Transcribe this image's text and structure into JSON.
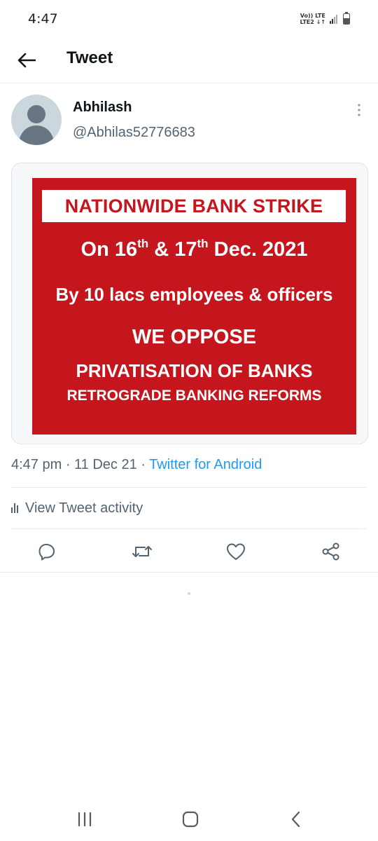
{
  "status_bar": {
    "time": "4:47",
    "network_line1": "Vo)) LTE",
    "network_line2": "LTE2 ↓↑",
    "battery_level": 0.6
  },
  "header": {
    "title": "Tweet",
    "back_icon": "arrow-left-icon"
  },
  "tweet": {
    "author_name": "Abhilash",
    "author_handle": "@Abhilas52776683",
    "more_icon": "vertical-dots-icon",
    "image": {
      "headline": "NATIONWIDE BANK STRIKE",
      "date_on": "On 16",
      "date_th1": "th",
      "date_mid": " & 17",
      "date_th2": "th",
      "date_end": " Dec. 2021",
      "by_line": "By 10 lacs employees & officers",
      "oppose": "WE OPPOSE",
      "privatisation": "PRIVATISATION OF BANKS",
      "retrograde": "RETROGRADE BANKING REFORMS",
      "bg_color": "#c4161c"
    },
    "meta": {
      "time": "4:47 pm",
      "separator": " · ",
      "date": "11 Dec 21",
      "source": "Twitter for Android"
    },
    "activity_label": "View Tweet activity",
    "activity_icon": "bar-chart-icon"
  },
  "actions": [
    {
      "name": "reply",
      "icon": "reply-icon"
    },
    {
      "name": "retweet",
      "icon": "retweet-icon"
    },
    {
      "name": "like",
      "icon": "heart-icon"
    },
    {
      "name": "share",
      "icon": "share-icon"
    }
  ],
  "colors": {
    "accent": "#1d9bf0",
    "secondary_text": "#536471",
    "poster_red": "#c4161c"
  },
  "nav_bar": {
    "recent_icon": "recent-apps-icon",
    "home_icon": "home-icon",
    "back_icon": "nav-back-icon"
  }
}
